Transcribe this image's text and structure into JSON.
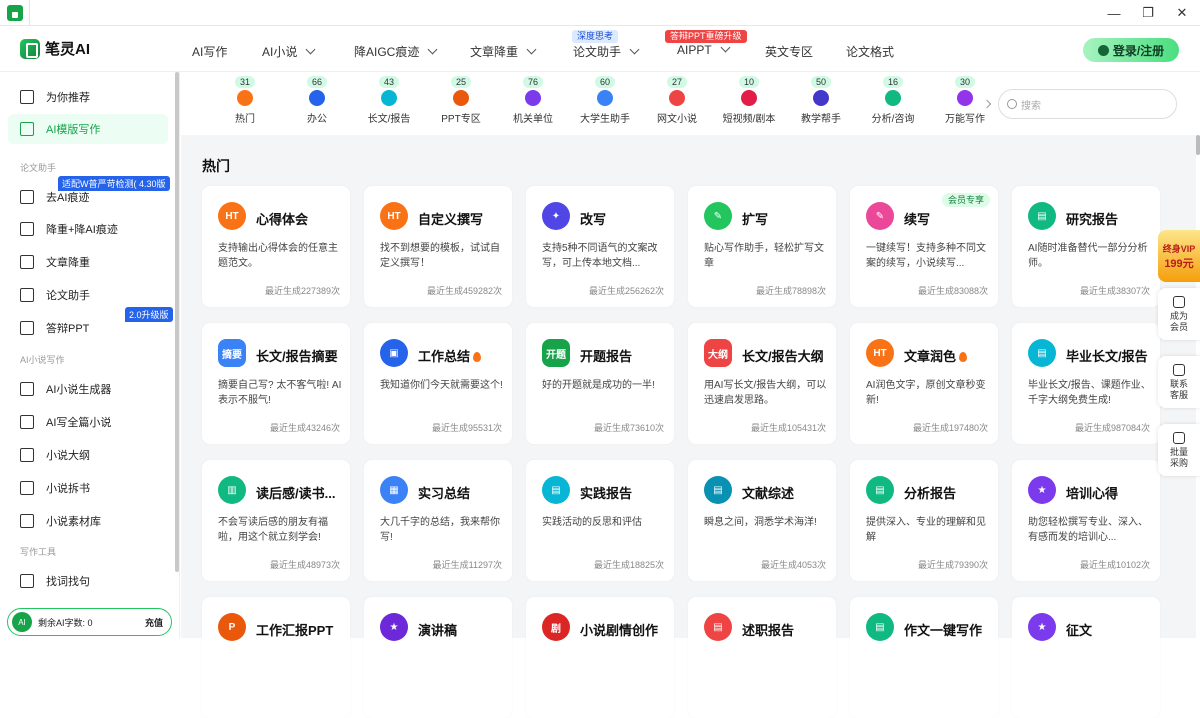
{
  "window": {
    "minimize": "—",
    "maximize": "❐",
    "close": "✕"
  },
  "header": {
    "logo": "笔灵AI",
    "nav": [
      {
        "label": "AI写作"
      },
      {
        "label": "AI小说"
      },
      {
        "label": "降AIGC痕迹"
      },
      {
        "label": "文章降重"
      },
      {
        "label": "论文助手",
        "badge": "深度思考"
      },
      {
        "label": "AIPPT",
        "badge": "答辩PPT重磅升级"
      },
      {
        "label": "英文专区"
      },
      {
        "label": "论文格式"
      }
    ],
    "login": "登录/注册"
  },
  "sidebar": {
    "items_top": [
      {
        "label": "为你推荐"
      },
      {
        "label": "AI模版写作"
      }
    ],
    "section_thesis": "论文助手",
    "badge_detect": "适配W普严苛检测( 4.30版",
    "items_thesis": [
      {
        "label": "去AI痕迹"
      },
      {
        "label": "降重+降AI痕迹"
      },
      {
        "label": "文章降重"
      },
      {
        "label": "论文助手"
      },
      {
        "label": "答辩PPT"
      }
    ],
    "badge_upgrade": "2.0升级版",
    "section_novel": "AI小说写作",
    "items_novel": [
      {
        "label": "AI小说生成器"
      },
      {
        "label": "AI写全篇小说"
      },
      {
        "label": "小说大纲"
      },
      {
        "label": "小说拆书"
      },
      {
        "label": "小说素材库"
      }
    ],
    "section_tools": "写作工具",
    "items_tools": [
      {
        "label": "找词找句"
      }
    ],
    "quota_avatar": "AI",
    "quota_text": "剩余AI字数: 0",
    "quota_btn": "充值"
  },
  "categories": [
    {
      "label": "热门",
      "count": "31",
      "color": "#f97316"
    },
    {
      "label": "办公",
      "count": "66",
      "color": "#2563eb"
    },
    {
      "label": "长文/报告",
      "count": "43",
      "color": "#06b6d4"
    },
    {
      "label": "PPT专区",
      "count": "25",
      "color": "#ea580c"
    },
    {
      "label": "机关单位",
      "count": "76",
      "color": "#7c3aed"
    },
    {
      "label": "大学生助手",
      "count": "60",
      "color": "#3b82f6"
    },
    {
      "label": "网文小说",
      "count": "27",
      "color": "#ef4444"
    },
    {
      "label": "短视频/剧本",
      "count": "10",
      "color": "#e11d48"
    },
    {
      "label": "教学帮手",
      "count": "50",
      "color": "#4338ca"
    },
    {
      "label": "分析/咨询",
      "count": "16",
      "color": "#10b981"
    },
    {
      "label": "万能写作",
      "count": "30",
      "color": "#9333ea"
    }
  ],
  "search_placeholder": "搜索",
  "section_title": "热门",
  "cards": [
    {
      "title": "心得体会",
      "desc": "支持输出心得体会的任意主题范文。",
      "stat": "最近生成227389次",
      "icon": "HT",
      "color": "#f97316",
      "round": true
    },
    {
      "title": "自定义撰写",
      "desc": "找不到想要的模板，试试自定义撰写！",
      "stat": "最近生成459282次",
      "icon": "HT",
      "color": "#f97316",
      "round": true
    },
    {
      "title": "改写",
      "desc": "支持5种不同语气的文案改写，可上传本地文档...",
      "stat": "最近生成256262次",
      "icon": "✦",
      "color": "#4f46e5",
      "round": true
    },
    {
      "title": "扩写",
      "desc": "贴心写作助手，轻松扩写文章",
      "stat": "最近生成78898次",
      "icon": "✎",
      "color": "#22c55e",
      "round": true
    },
    {
      "title": "续写",
      "desc": "一键续写！支持多种不同文案的续写，小说续写...",
      "stat": "最近生成83088次",
      "icon": "✎",
      "color": "#ec4899",
      "round": true,
      "tag": "会员专享"
    },
    {
      "title": "研究报告",
      "desc": "AI随时准备替代一部分分析师。",
      "stat": "最近生成38307次",
      "icon": "▤",
      "color": "#10b981",
      "round": true
    },
    {
      "title": "长文/报告摘要",
      "desc": "摘要自己写? 太不客气啦! AI表示不服气!",
      "stat": "最近生成43246次",
      "icon": "摘要",
      "color": "#3b82f6",
      "round": false
    },
    {
      "title": "工作总结",
      "desc": "我知道你们今天就需要这个!",
      "stat": "最近生成95531次",
      "icon": "▣",
      "color": "#2563eb",
      "round": true,
      "fire": true
    },
    {
      "title": "开题报告",
      "desc": "好的开题就是成功的一半!",
      "stat": "最近生成73610次",
      "icon": "开题",
      "color": "#16a34a",
      "round": false
    },
    {
      "title": "长文/报告大纲",
      "desc": "用AI写长文/报告大纲，可以迅速启发思路。",
      "stat": "最近生成105431次",
      "icon": "大纲",
      "color": "#ef4444",
      "round": false
    },
    {
      "title": "文章润色",
      "desc": "AI润色文字，原创文章秒变新!",
      "stat": "最近生成197480次",
      "icon": "HT",
      "color": "#f97316",
      "round": true,
      "fire": true
    },
    {
      "title": "毕业长文/报告",
      "desc": "毕业长文/报告、课题作业、千字大纲免费生成!",
      "stat": "最近生成987084次",
      "icon": "▤",
      "color": "#06b6d4",
      "round": true
    },
    {
      "title": "读后感/读书...",
      "desc": "不会写读后感的朋友有福啦，用这个就立刻学会!",
      "stat": "最近生成48973次",
      "icon": "▥",
      "color": "#10b981",
      "round": true
    },
    {
      "title": "实习总结",
      "desc": "大几千字的总结，我来帮你写!",
      "stat": "最近生成11297次",
      "icon": "▦",
      "color": "#3b82f6",
      "round": true
    },
    {
      "title": "实践报告",
      "desc": "实践活动的反思和评估",
      "stat": "最近生成18825次",
      "icon": "▤",
      "color": "#06b6d4",
      "round": true
    },
    {
      "title": "文献综述",
      "desc": "瞬息之间，洞悉学术海洋!",
      "stat": "最近生成4053次",
      "icon": "▤",
      "color": "#0891b2",
      "round": true
    },
    {
      "title": "分析报告",
      "desc": "提供深入、专业的理解和见解",
      "stat": "最近生成79390次",
      "icon": "▤",
      "color": "#10b981",
      "round": true
    },
    {
      "title": "培训心得",
      "desc": "助您轻松撰写专业、深入、有感而发的培训心...",
      "stat": "最近生成10102次",
      "icon": "★",
      "color": "#7c3aed",
      "round": true
    },
    {
      "title": "工作汇报PPT",
      "desc": "",
      "stat": "",
      "icon": "P",
      "color": "#ea580c",
      "round": true
    },
    {
      "title": "演讲稿",
      "desc": "",
      "stat": "",
      "icon": "★",
      "color": "#6d28d9",
      "round": true
    },
    {
      "title": "小说剧情创作",
      "desc": "",
      "stat": "",
      "icon": "剧",
      "color": "#dc2626",
      "round": true
    },
    {
      "title": "述职报告",
      "desc": "",
      "stat": "",
      "icon": "▤",
      "color": "#ef4444",
      "round": true
    },
    {
      "title": "作文一键写作",
      "desc": "",
      "stat": "",
      "icon": "▤",
      "color": "#10b981",
      "round": true
    },
    {
      "title": "征文",
      "desc": "",
      "stat": "",
      "icon": "★",
      "color": "#7c3aed",
      "round": true
    }
  ],
  "floatbar": {
    "vip_line1": "终身VIP",
    "vip_line2": "199元",
    "items": [
      {
        "label": "成为会员"
      },
      {
        "label": "联系客服"
      },
      {
        "label": "批量采购"
      }
    ]
  }
}
